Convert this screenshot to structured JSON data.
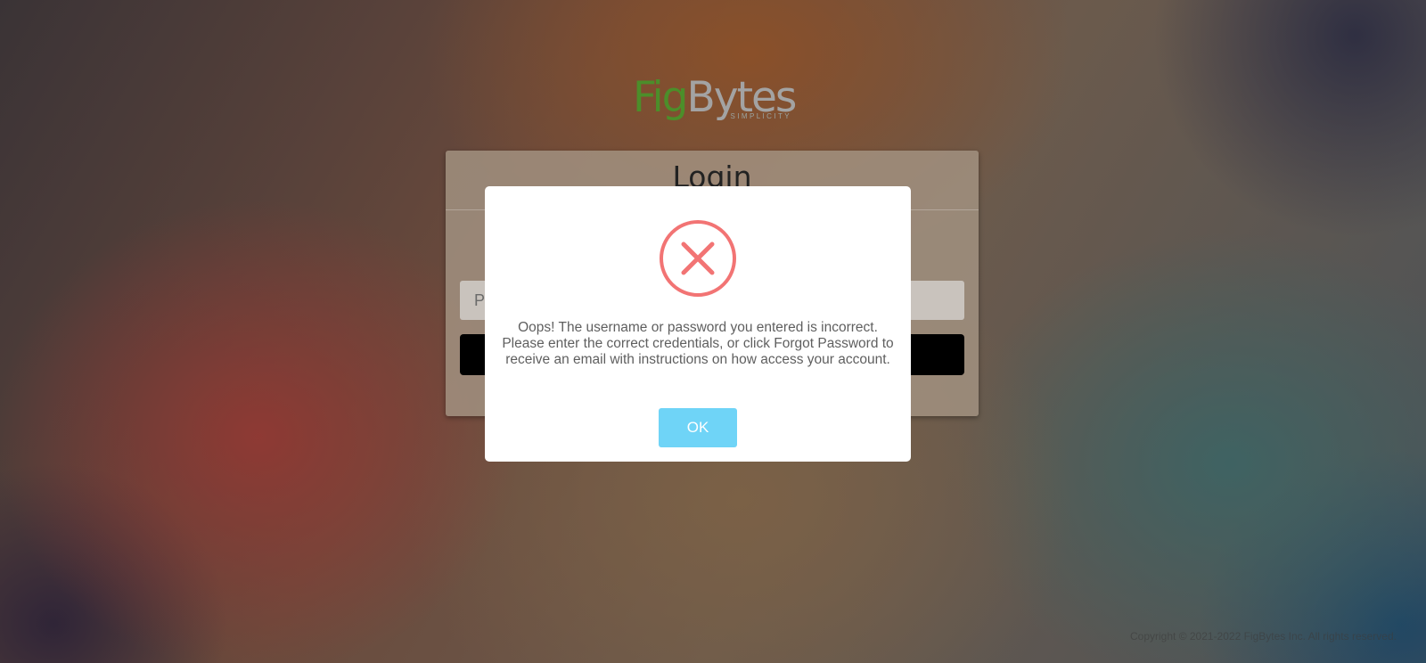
{
  "logo": {
    "brand_first": "Fig",
    "brand_second": "Bytes",
    "tagline": "SIMPLICITY"
  },
  "login": {
    "title": "Login",
    "password_placeholder": "Password",
    "submit_label": ""
  },
  "modal": {
    "icon": "error-x-icon",
    "message": "Oops! The username or password you entered is incorrect. Please enter the correct credentials, or click Forgot Password to receive an email with instructions on how access your account.",
    "ok_label": "OK"
  },
  "footer": {
    "copyright": "Copyright © 2021-2022 FigBytes Inc. All rights reserved."
  },
  "colors": {
    "accent": "#6fd4f7",
    "error": "#f27474",
    "brand_green": "#4c8e2a"
  }
}
